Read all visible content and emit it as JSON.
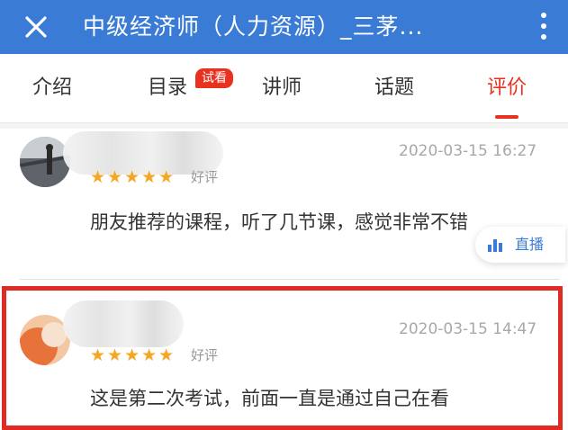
{
  "header": {
    "title": "中级经济师（人力资源）_三茅...",
    "close_icon": "close-icon",
    "more_icon": "more-vertical-icon",
    "color": "#3a7bd5"
  },
  "tabs": [
    {
      "label": "介绍"
    },
    {
      "label": "目录",
      "badge": "试看"
    },
    {
      "label": "讲师"
    },
    {
      "label": "话题"
    },
    {
      "label": "评价",
      "active": true
    }
  ],
  "accent_color": "#e8321f",
  "reviews": [
    {
      "time": "2020-03-15 16:27",
      "stars": "★★★★★",
      "rating_label": "好评",
      "content": "朋友推荐的课程，听了几节课，感觉非常不错"
    },
    {
      "time": "2020-03-15 14:47",
      "stars": "★★★★★",
      "rating_label": "好评",
      "content": "这是第二次考试，前面一直是通过自己在看"
    }
  ],
  "live_button": {
    "label": "直播",
    "icon": "bar-chart-icon"
  }
}
